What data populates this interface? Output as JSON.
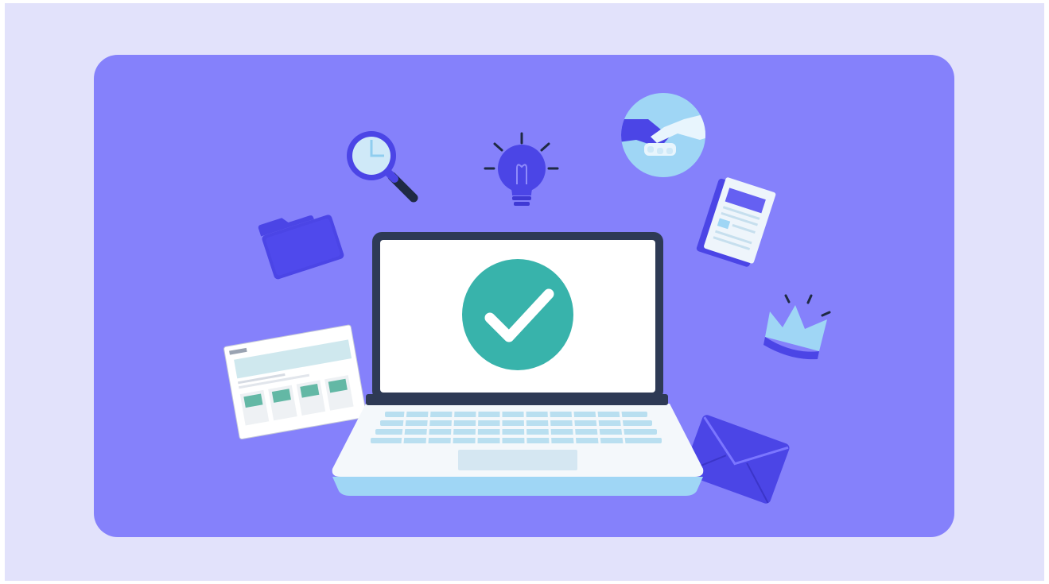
{
  "illustration": {
    "background_color": "#e2e2fb",
    "card_color": "#8581fb",
    "accent_dark": "#4b45e6",
    "accent_light": "#9fd6f5",
    "check_color": "#38b3ab",
    "icons": [
      "laptop-icon",
      "checkmark-icon",
      "magnifier-icon",
      "lightbulb-icon",
      "handshake-icon",
      "document-icon",
      "folder-icon",
      "crown-icon",
      "envelope-icon",
      "dashboard-screenshot-icon"
    ]
  }
}
